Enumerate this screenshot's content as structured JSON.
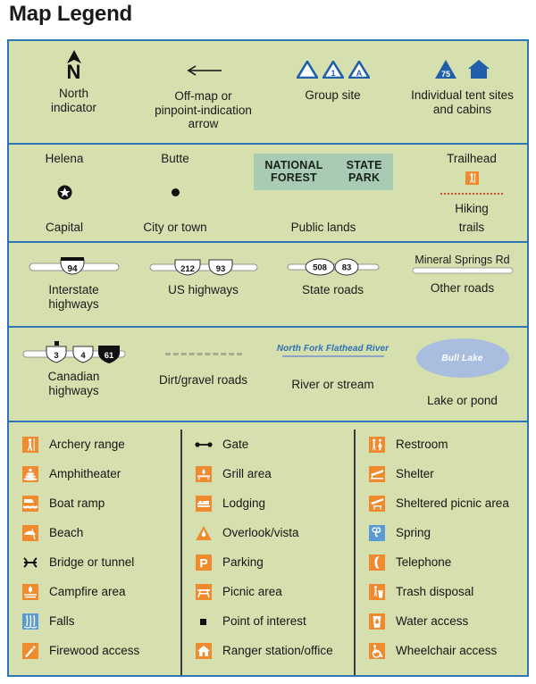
{
  "title": "Map Legend",
  "colors": {
    "panel_background": "#d6e0ae",
    "border_blue": "#2e75b6",
    "icon_orange": "#f08a2e",
    "icon_blue": "#5b9bd5",
    "public_lands_box": "#a9cbb4",
    "water_blue": "#a9bede",
    "symbol_blue": "#1f5fa9",
    "trail_red": "#cf4b2a",
    "dirt_gray": "#a7ac90"
  },
  "section_orientation": {
    "north": {
      "label_line1": "North",
      "label_line2": "indicator",
      "letter": "N",
      "icon": "north-arrow-icon"
    },
    "offmap": {
      "label_line1": "Off-map or",
      "label_line2": "pinpoint-indication",
      "label_line3": "arrow",
      "icon": "left-arrow-icon"
    },
    "group_site": {
      "label": "Group site",
      "markers": [
        "",
        "1",
        "A"
      ],
      "icon": "group-site-triangle-icon"
    },
    "individual": {
      "label_line1": "Individual tent sites",
      "label_line2": "and cabins",
      "tent_number": "75",
      "icon": "tent-site-icon"
    }
  },
  "section_places": {
    "capital": {
      "name": "Helena",
      "label": "Capital",
      "icon": "capital-star-icon"
    },
    "city": {
      "name": "Butte",
      "label": "City or town",
      "icon": "city-dot-icon"
    },
    "public_lands": {
      "label": "Public lands",
      "names": [
        {
          "line1": "NATIONAL",
          "line2": "FOREST"
        },
        {
          "line1": "STATE",
          "line2": "PARK"
        }
      ]
    },
    "trailhead": {
      "name": "Trailhead",
      "label_line1": "Hiking",
      "label_line2": "trails",
      "icon": "trailhead-hiker-icon"
    }
  },
  "section_roads": {
    "interstate": {
      "label_line1": "Interstate",
      "label_line2": "highways",
      "shields": [
        "94"
      ]
    },
    "us": {
      "label": "US highways",
      "shields": [
        "212",
        "93"
      ]
    },
    "state": {
      "label": "State roads",
      "shields": [
        "508",
        "83"
      ]
    },
    "other": {
      "label": "Other roads",
      "name": "Mineral Springs Rd"
    }
  },
  "section_water": {
    "canadian": {
      "label_line1": "Canadian",
      "label_line2": "highways",
      "shields": [
        "3",
        "4",
        "61"
      ]
    },
    "dirt": {
      "label": "Dirt/gravel roads"
    },
    "river": {
      "label": "River or stream",
      "name": "North Fork Flathead River"
    },
    "lake": {
      "label": "Lake or pond",
      "name": "Bull Lake"
    }
  },
  "symbols": {
    "column1": [
      {
        "label": "Archery range",
        "icon": "archery-range-icon",
        "style": "orange"
      },
      {
        "label": "Amphitheater",
        "icon": "amphitheater-icon",
        "style": "orange"
      },
      {
        "label": "Boat ramp",
        "icon": "boat-ramp-icon",
        "style": "orange"
      },
      {
        "label": "Beach",
        "icon": "beach-icon",
        "style": "orange"
      },
      {
        "label": "Bridge or tunnel",
        "icon": "bridge-tunnel-icon",
        "style": "black"
      },
      {
        "label": "Campfire area",
        "icon": "campfire-area-icon",
        "style": "orange"
      },
      {
        "label": "Falls",
        "icon": "falls-icon",
        "style": "blue"
      },
      {
        "label": "Firewood access",
        "icon": "firewood-access-icon",
        "style": "orange"
      }
    ],
    "column2": [
      {
        "label": "Gate",
        "icon": "gate-icon",
        "style": "black"
      },
      {
        "label": "Grill area",
        "icon": "grill-area-icon",
        "style": "orange"
      },
      {
        "label": "Lodging",
        "icon": "lodging-icon",
        "style": "orange"
      },
      {
        "label": "Overlook/vista",
        "icon": "overlook-vista-icon",
        "style": "orange"
      },
      {
        "label": "Parking",
        "icon": "parking-icon",
        "style": "orange"
      },
      {
        "label": "Picnic area",
        "icon": "picnic-area-icon",
        "style": "orange"
      },
      {
        "label": "Point of interest",
        "icon": "point-of-interest-icon",
        "style": "black"
      },
      {
        "label": "Ranger station/office",
        "icon": "ranger-station-icon",
        "style": "orange"
      }
    ],
    "column3": [
      {
        "label": "Restroom",
        "icon": "restroom-icon",
        "style": "orange"
      },
      {
        "label": "Shelter",
        "icon": "shelter-icon",
        "style": "orange"
      },
      {
        "label": "Sheltered picnic area",
        "icon": "sheltered-picnic-icon",
        "style": "orange"
      },
      {
        "label": "Spring",
        "icon": "spring-icon",
        "style": "blue"
      },
      {
        "label": "Telephone",
        "icon": "telephone-icon",
        "style": "orange"
      },
      {
        "label": "Trash disposal",
        "icon": "trash-disposal-icon",
        "style": "orange"
      },
      {
        "label": "Water access",
        "icon": "water-access-icon",
        "style": "orange"
      },
      {
        "label": "Wheelchair access",
        "icon": "wheelchair-access-icon",
        "style": "orange"
      }
    ]
  }
}
